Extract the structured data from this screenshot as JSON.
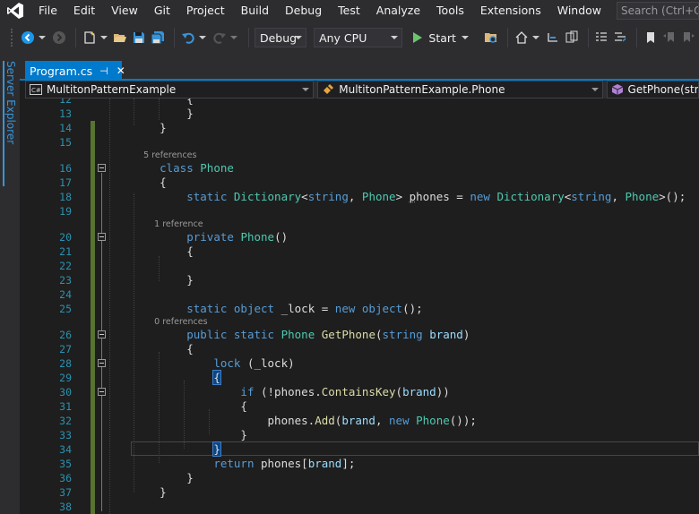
{
  "menu": {
    "items": [
      "File",
      "Edit",
      "View",
      "Git",
      "Project",
      "Build",
      "Debug",
      "Test",
      "Analyze",
      "Tools",
      "Extensions",
      "Window",
      "Help"
    ],
    "search_placeholder": "Search (Ctrl+Q)"
  },
  "toolbar": {
    "configuration": "Debug",
    "platform": "Any CPU",
    "start_label": "Start"
  },
  "side_panel": {
    "label": "Server Explorer"
  },
  "document_tab": {
    "filename": "Program.cs",
    "pin_glyph": "⊣",
    "close_glyph": "✕"
  },
  "navigation": {
    "project": "MultitonPatternExample",
    "type": "MultitonPatternExample.Phone",
    "member": "GetPhone(string brand)"
  },
  "editor": {
    "line_numbers": [
      "12",
      "13",
      "14",
      "15",
      "16",
      "17",
      "18",
      "19",
      "20",
      "21",
      "22",
      "23",
      "24",
      "25",
      "26",
      "27",
      "28",
      "29",
      "30",
      "31",
      "32",
      "33",
      "34",
      "35",
      "36",
      "37",
      "38"
    ],
    "lens": {
      "phone_class": "5 references",
      "ctor": "1 reference",
      "getphone": "0 references"
    },
    "colors": {
      "keyword": "#569cd6",
      "type": "#4ec9b0",
      "method": "#dcdcaa",
      "param": "#9cdcfe",
      "plain": "#dcdcdc",
      "line_number": "#2b91af"
    }
  }
}
